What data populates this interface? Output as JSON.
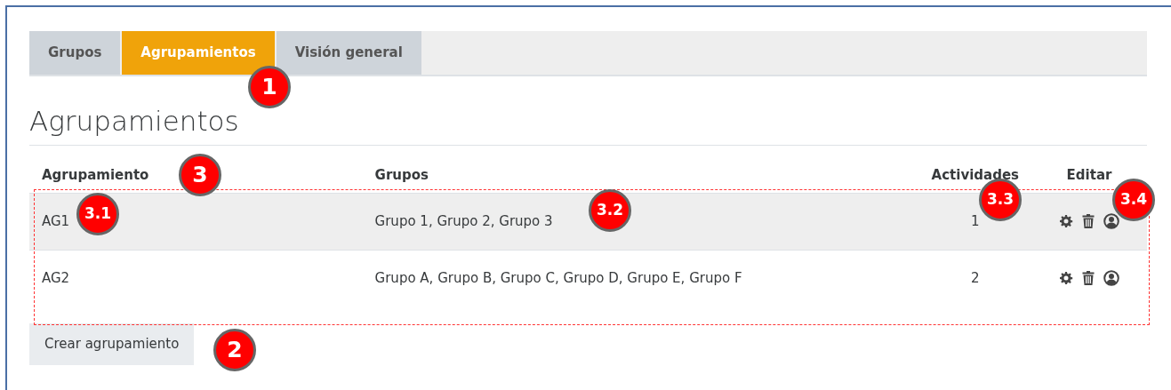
{
  "tabs": [
    {
      "label": "Grupos",
      "selected": false
    },
    {
      "label": "Agrupamientos",
      "selected": true
    },
    {
      "label": "Visión general",
      "selected": false
    }
  ],
  "heading": "Agrupamientos",
  "table": {
    "columns": [
      "Agrupamiento",
      "Grupos",
      "Actividades",
      "Editar"
    ],
    "rows": [
      {
        "name": "AG1",
        "groups": "Grupo 1, Grupo 2, Grupo 3",
        "activities": "1",
        "highlighted": true
      },
      {
        "name": "AG2",
        "groups": "Grupo A, Grupo B, Grupo C, Grupo D, Grupo E, Grupo F",
        "activities": "2",
        "highlighted": false
      }
    ]
  },
  "create_button": "Crear agrupamiento",
  "callouts": [
    "1",
    "3",
    "3.1",
    "3.2",
    "3.3",
    "3.4",
    "2"
  ]
}
